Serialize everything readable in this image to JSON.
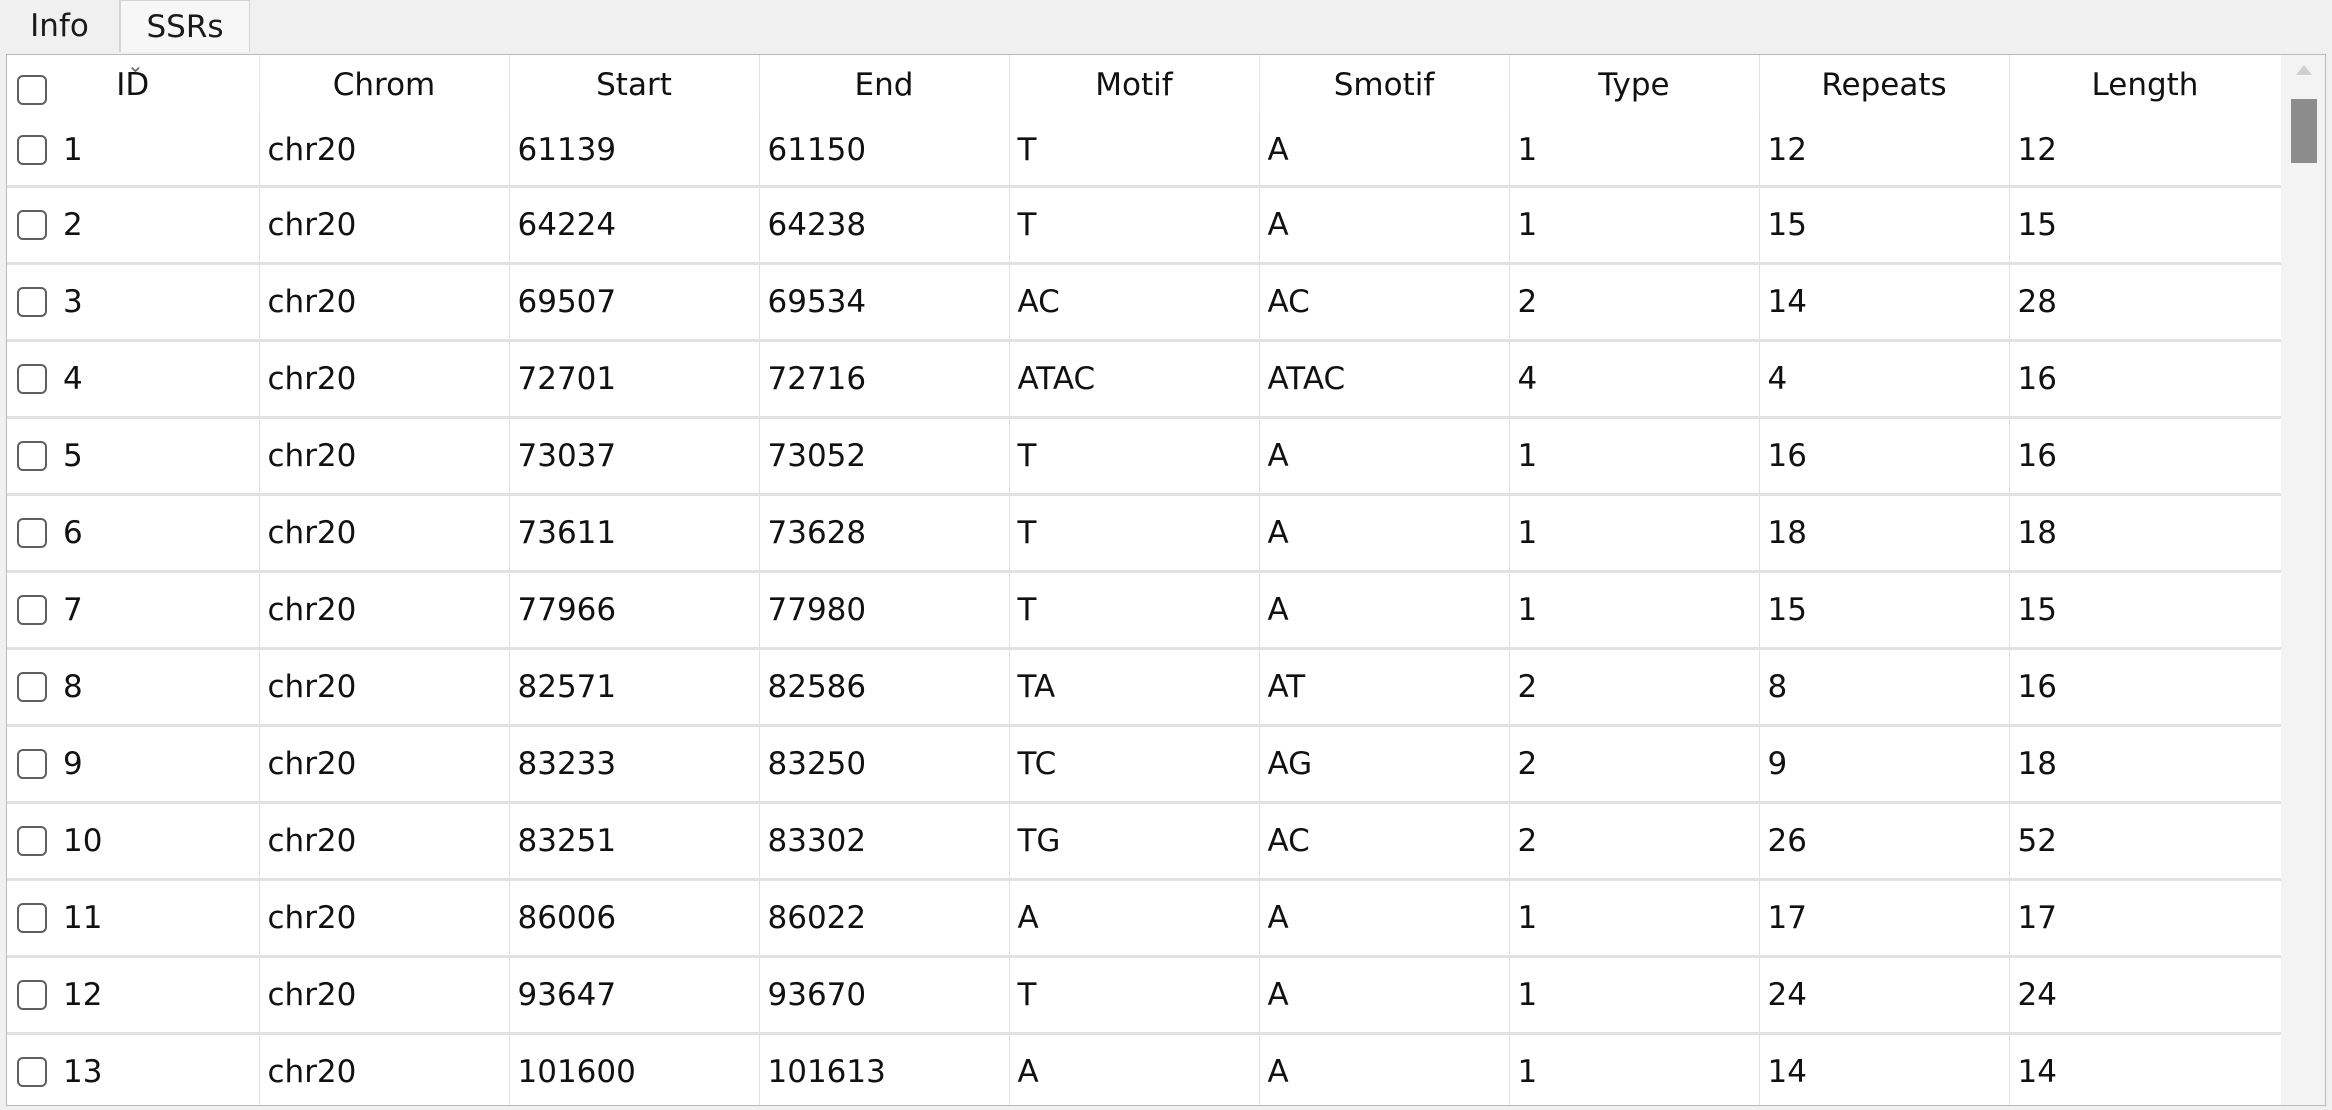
{
  "tabs": [
    {
      "label": "Info"
    },
    {
      "label": "SSRs"
    }
  ],
  "table": {
    "columns": [
      "ID",
      "Chrom",
      "Start",
      "End",
      "Motif",
      "Smotif",
      "Type",
      "Repeats",
      "Length"
    ],
    "sort_icon": "chevron-down-icon",
    "rows": [
      [
        "1",
        "chr20",
        "61139",
        "61150",
        "T",
        "A",
        "1",
        "12",
        "12"
      ],
      [
        "2",
        "chr20",
        "64224",
        "64238",
        "T",
        "A",
        "1",
        "15",
        "15"
      ],
      [
        "3",
        "chr20",
        "69507",
        "69534",
        "AC",
        "AC",
        "2",
        "14",
        "28"
      ],
      [
        "4",
        "chr20",
        "72701",
        "72716",
        "ATAC",
        "ATAC",
        "4",
        "4",
        "16"
      ],
      [
        "5",
        "chr20",
        "73037",
        "73052",
        "T",
        "A",
        "1",
        "16",
        "16"
      ],
      [
        "6",
        "chr20",
        "73611",
        "73628",
        "T",
        "A",
        "1",
        "18",
        "18"
      ],
      [
        "7",
        "chr20",
        "77966",
        "77980",
        "T",
        "A",
        "1",
        "15",
        "15"
      ],
      [
        "8",
        "chr20",
        "82571",
        "82586",
        "TA",
        "AT",
        "2",
        "8",
        "16"
      ],
      [
        "9",
        "chr20",
        "83233",
        "83250",
        "TC",
        "AG",
        "2",
        "9",
        "18"
      ],
      [
        "10",
        "chr20",
        "83251",
        "83302",
        "TG",
        "AC",
        "2",
        "26",
        "52"
      ],
      [
        "11",
        "chr20",
        "86006",
        "86022",
        "A",
        "A",
        "1",
        "17",
        "17"
      ],
      [
        "12",
        "chr20",
        "93647",
        "93670",
        "T",
        "A",
        "1",
        "24",
        "24"
      ],
      [
        "13",
        "chr20",
        "101600",
        "101613",
        "A",
        "A",
        "1",
        "14",
        "14"
      ]
    ]
  }
}
